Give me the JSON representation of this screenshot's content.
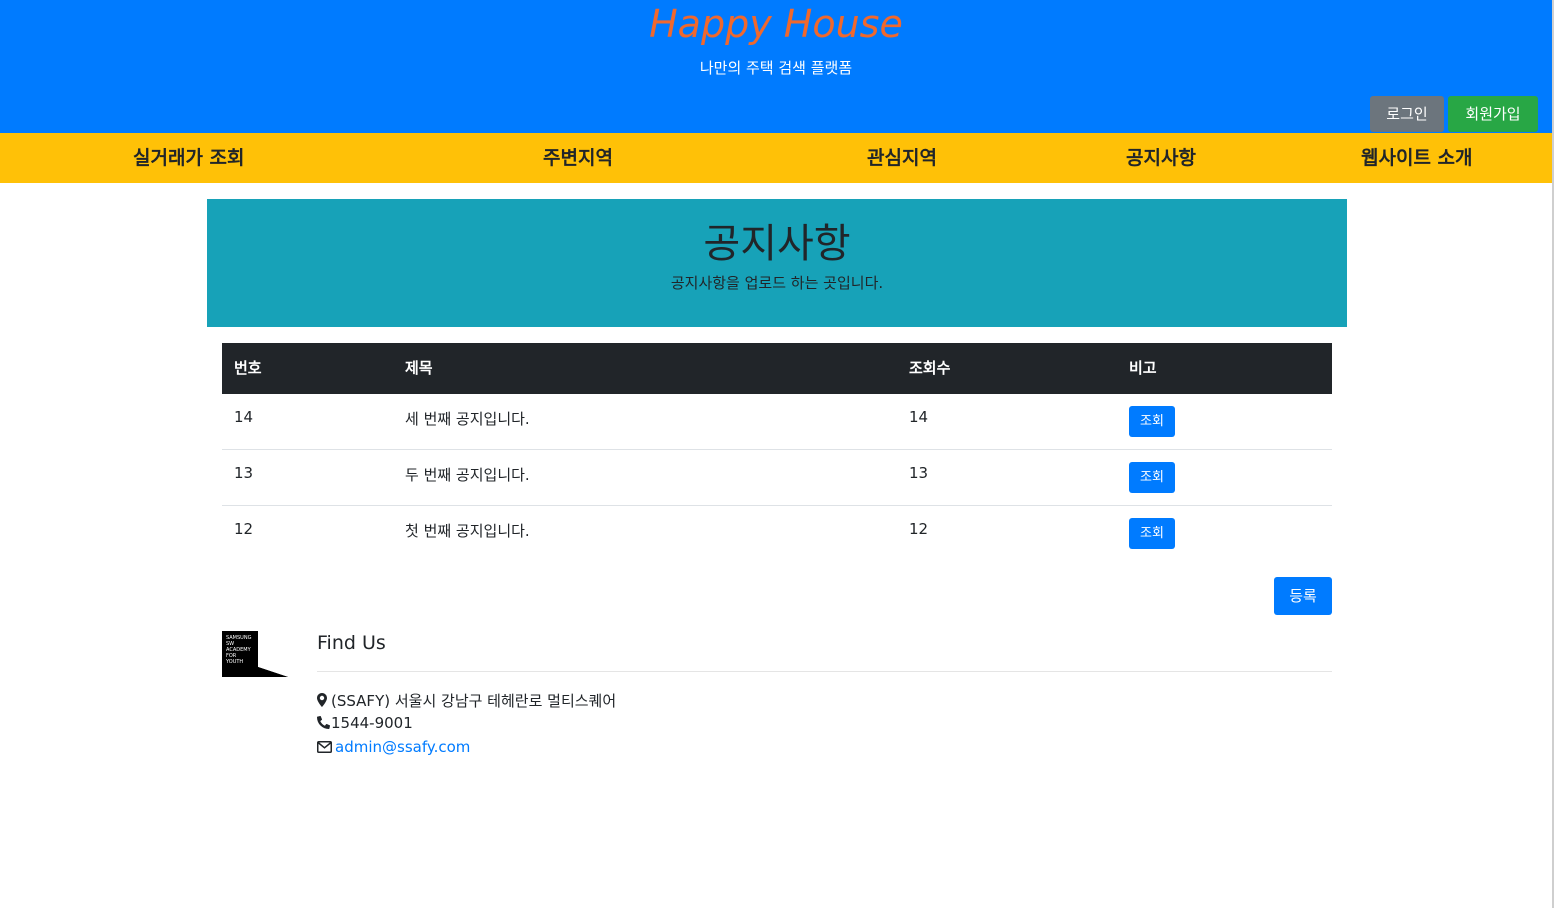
{
  "header": {
    "brand": "Happy House",
    "subtitle": "나만의 주택 검색 플랫폼",
    "login_label": "로그인",
    "join_label": "회원가입"
  },
  "nav": {
    "items": [
      {
        "label": "실거래가 조회"
      },
      {
        "label": "주변지역"
      },
      {
        "label": "관심지역"
      },
      {
        "label": "공지사항"
      },
      {
        "label": "웹사이트 소개"
      }
    ]
  },
  "jumbotron": {
    "title": "공지사항",
    "description": "공지사항을 업로드 하는 곳입니다."
  },
  "table": {
    "columns": [
      "번호",
      "제목",
      "조회수",
      "비고"
    ],
    "rows": [
      {
        "no": "14",
        "title": "세 번째 공지입니다.",
        "views": "14",
        "action": "조회"
      },
      {
        "no": "13",
        "title": "두 번째 공지입니다.",
        "views": "13",
        "action": "조회"
      },
      {
        "no": "12",
        "title": "첫 번째 공지입니다.",
        "views": "12",
        "action": "조회"
      }
    ]
  },
  "register_label": "등록",
  "footer": {
    "logo_text": [
      "SAMSUNG",
      "SW",
      "ACADEMY",
      "FOR",
      "YOUTH"
    ],
    "title": "Find Us",
    "address": "(SSAFY) 서울시 강남구 테헤란로 멀티스퀘어",
    "phone": "1544-9001",
    "email": "admin@ssafy.com"
  },
  "colors": {
    "header_bg": "#007bff",
    "brand": "#f0682d",
    "nav_bg": "#ffc107",
    "jumbotron_bg": "#17a2b8",
    "table_head_bg": "#212529",
    "primary": "#007bff",
    "secondary": "#6c757d",
    "success": "#28a745"
  }
}
